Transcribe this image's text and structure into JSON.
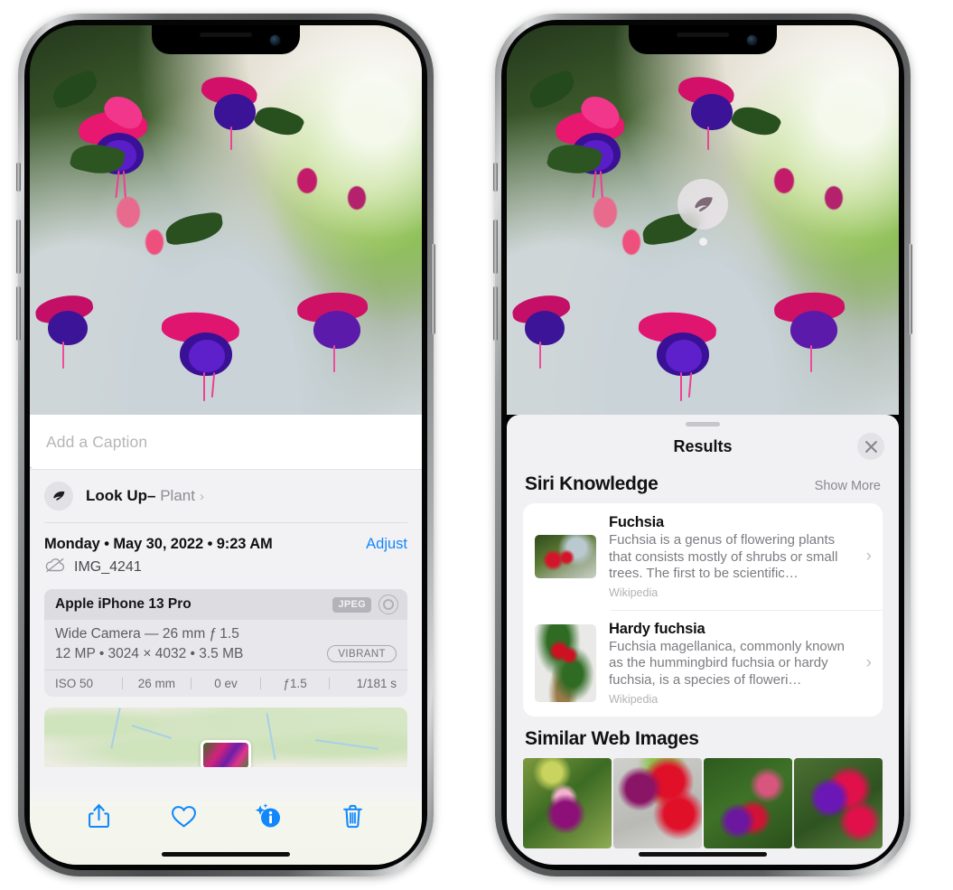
{
  "left_phone": {
    "name": "photos-detail-screen",
    "caption": {
      "placeholder": "Add a Caption",
      "value": ""
    },
    "lookup": {
      "icon": "leaf-icon",
      "label": "Look Up",
      "dash": "–",
      "subject": "Plant",
      "chevron": "›"
    },
    "date_row": {
      "date": "Monday • May 30, 2022 • 9:23 AM",
      "adjust_label": "Adjust"
    },
    "file_row": {
      "icon": "cloud-slash-icon",
      "filename": "IMG_4241"
    },
    "exif": {
      "device": "Apple iPhone 13 Pro",
      "format_badge": "JPEG",
      "lens_icon": "aperture-icon",
      "lens_line": "Wide Camera — 26 mm ƒ 1.5",
      "specs_line": "12 MP • 3024 × 4032 • 3.5 MB",
      "style_pill": "VIBRANT",
      "footer": [
        "ISO 50",
        "26 mm",
        "0 ev",
        "ƒ1.5",
        "1/181 s"
      ]
    },
    "map": {
      "name": "location-map-preview"
    },
    "toolbar": [
      {
        "name": "share-button",
        "icon": "share-icon"
      },
      {
        "name": "favorite-button",
        "icon": "heart-icon"
      },
      {
        "name": "info-button",
        "icon": "info-sparkle-icon"
      },
      {
        "name": "delete-button",
        "icon": "trash-icon"
      }
    ],
    "accent_color": "#1287fb"
  },
  "right_phone": {
    "name": "visual-lookup-results-screen",
    "leaf_badge": {
      "icon": "leaf-icon"
    },
    "sheet": {
      "title": "Results",
      "close_icon": "close-icon",
      "sections": [
        {
          "heading": "Siri Knowledge",
          "action_label": "Show More",
          "items": [
            {
              "title": "Fuchsia",
              "description": "Fuchsia is a genus of flowering plants that consists mostly of shrubs or small trees. The first to be scientific…",
              "source": "Wikipedia",
              "chevron": "›",
              "thumb": "fuchsia-red-flowers-thumbnail"
            },
            {
              "title": "Hardy fuchsia",
              "description": "Fuchsia magellanica, commonly known as the hummingbird fuchsia or hardy fuchsia, is a species of floweri…",
              "source": "Wikipedia",
              "chevron": "›",
              "thumb": "hardy-fuchsia-branch-thumbnail"
            }
          ]
        },
        {
          "heading": "Similar Web Images",
          "images": [
            {
              "name": "web-image-1-magenta-fuchsia"
            },
            {
              "name": "web-image-2-red-fuchsia-closeup"
            },
            {
              "name": "web-image-3-fuchsia-bush"
            },
            {
              "name": "web-image-4-purple-fuchsia-cluster"
            }
          ]
        }
      ]
    }
  }
}
